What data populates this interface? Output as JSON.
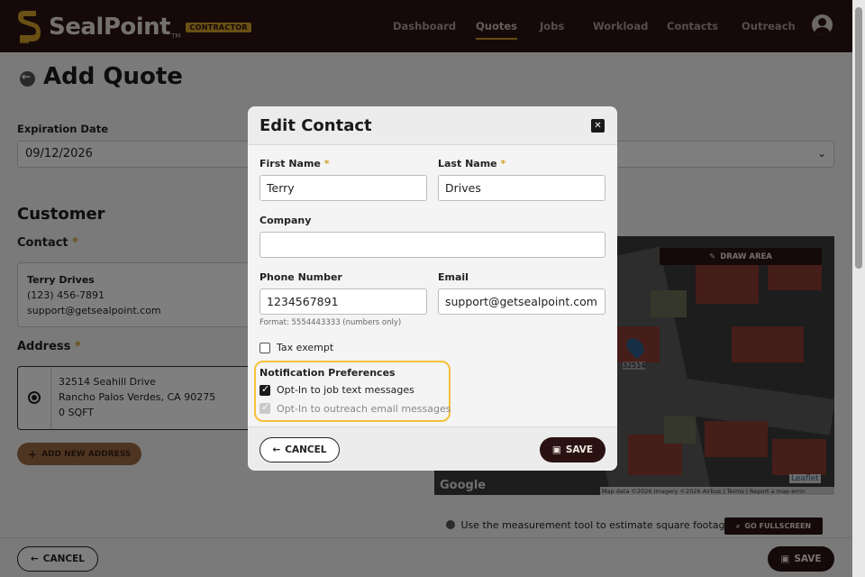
{
  "header": {
    "brand": "SealPoint",
    "brand_tm": "TM",
    "badge": "CONTRACTOR",
    "nav": [
      {
        "label": "Dashboard",
        "active": false
      },
      {
        "label": "Quotes",
        "active": true
      },
      {
        "label": "Jobs",
        "active": false
      },
      {
        "label": "Workload",
        "active": false
      },
      {
        "label": "Contacts",
        "active": false
      },
      {
        "label": "Outreach",
        "active": false
      }
    ]
  },
  "page": {
    "title": "Add Quote",
    "expiration_label": "Expiration Date",
    "expiration_value": "09/12/2026",
    "customer_heading": "Customer",
    "contact_label": "Contact",
    "contact": {
      "name": "Terry Drives",
      "phone": "(123) 456-7891",
      "email": "support@getsealpoint.com"
    },
    "address_label": "Address",
    "address": {
      "line1": "32514 Seahill Drive",
      "line2": "Rancho Palos Verdes, CA 90275",
      "sqft": "0 SQFT"
    },
    "add_address": "ADD NEW ADDRESS",
    "map": {
      "draw_area": "DRAW AREA",
      "pin_label": "32514",
      "leaflet": "Leaflet",
      "attribution": "Map data ©2026 Imagery ©2026 Airbus  |  Terms  |  Report a map error",
      "google": "Google"
    },
    "tool_note": "Use the measurement tool to estimate square footage",
    "fullscreen": "GO FULLSCREEN",
    "cancel": "CANCEL",
    "save": "SAVE"
  },
  "modal": {
    "title": "Edit Contact",
    "first_name_label": "First Name",
    "first_name_value": "Terry",
    "last_name_label": "Last Name",
    "last_name_value": "Drives",
    "company_label": "Company",
    "company_value": "",
    "phone_label": "Phone Number",
    "phone_value": "1234567891",
    "phone_hint": "Format: 5554443333 (numbers only)",
    "email_label": "Email",
    "email_value": "support@getsealpoint.com",
    "tax_exempt_label": "Tax exempt",
    "notif_heading": "Notification Preferences",
    "opt_in_text": "Opt-In to job text messages",
    "opt_in_email": "Opt-In to outreach email messages",
    "cancel": "CANCEL",
    "save": "SAVE"
  },
  "colors": {
    "header_bg": "#2a1212",
    "accent": "#d3a12a",
    "highlight": "#f4c13a"
  }
}
